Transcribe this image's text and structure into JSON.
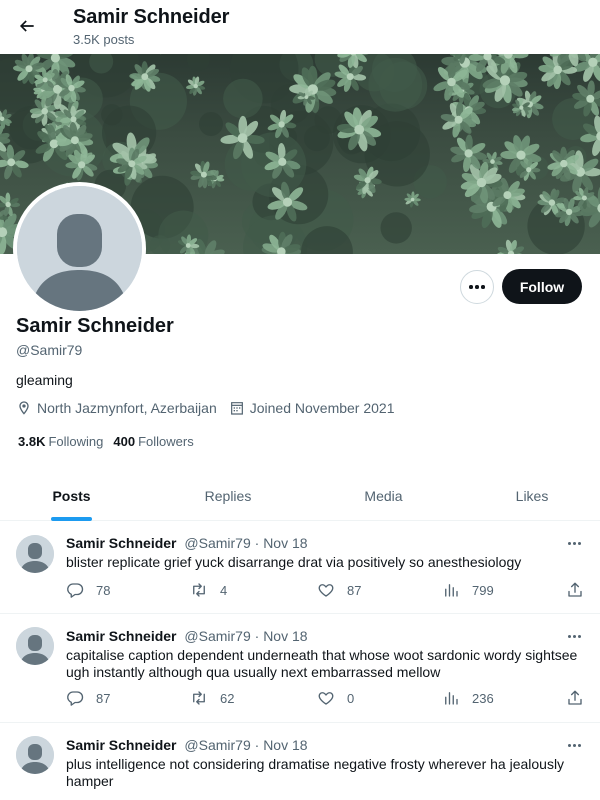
{
  "header": {
    "title": "Samir Schneider",
    "post_count": "3.5K posts"
  },
  "profile": {
    "name": "Samir Schneider",
    "handle": "@Samir79",
    "bio": "gleaming",
    "location": "North Jazmynfort, Azerbaijan",
    "joined": "Joined November 2021",
    "following_count": "3.8K",
    "following_label": "Following",
    "followers_count": "400",
    "followers_label": "Followers",
    "follow_button": "Follow"
  },
  "tabs": [
    {
      "label": "Posts",
      "active": true
    },
    {
      "label": "Replies",
      "active": false
    },
    {
      "label": "Media",
      "active": false
    },
    {
      "label": "Likes",
      "active": false
    }
  ],
  "posts": [
    {
      "author": "Samir Schneider",
      "handle": "@Samir79",
      "dot": "·",
      "date": "Nov 18",
      "text": "blister replicate grief yuck disarrange drat via positively so anesthesiology",
      "replies": "78",
      "reposts": "4",
      "likes": "87",
      "views": "799"
    },
    {
      "author": "Samir Schneider",
      "handle": "@Samir79",
      "dot": "·",
      "date": "Nov 18",
      "text": "capitalise caption dependent underneath that whose woot sardonic wordy sightsee ugh instantly although qua usually next embarrassed mellow",
      "replies": "87",
      "reposts": "62",
      "likes": "0",
      "views": "236"
    },
    {
      "author": "Samir Schneider",
      "handle": "@Samir79",
      "dot": "·",
      "date": "Nov 18",
      "text": "plus intelligence not considering dramatise negative frosty wherever ha jealously hamper",
      "replies": "",
      "reposts": "",
      "likes": "",
      "views": ""
    }
  ],
  "colors": {
    "accent": "#1d9bf0",
    "text_primary": "#0f1419",
    "text_secondary": "#536471",
    "follow_bg": "#0f1419"
  },
  "icons": {
    "back": "arrow-left-icon",
    "location": "location-pin-icon",
    "calendar": "calendar-icon",
    "reply": "reply-icon",
    "repost": "repost-icon",
    "like": "heart-icon",
    "views": "views-chart-icon",
    "share": "share-icon"
  }
}
